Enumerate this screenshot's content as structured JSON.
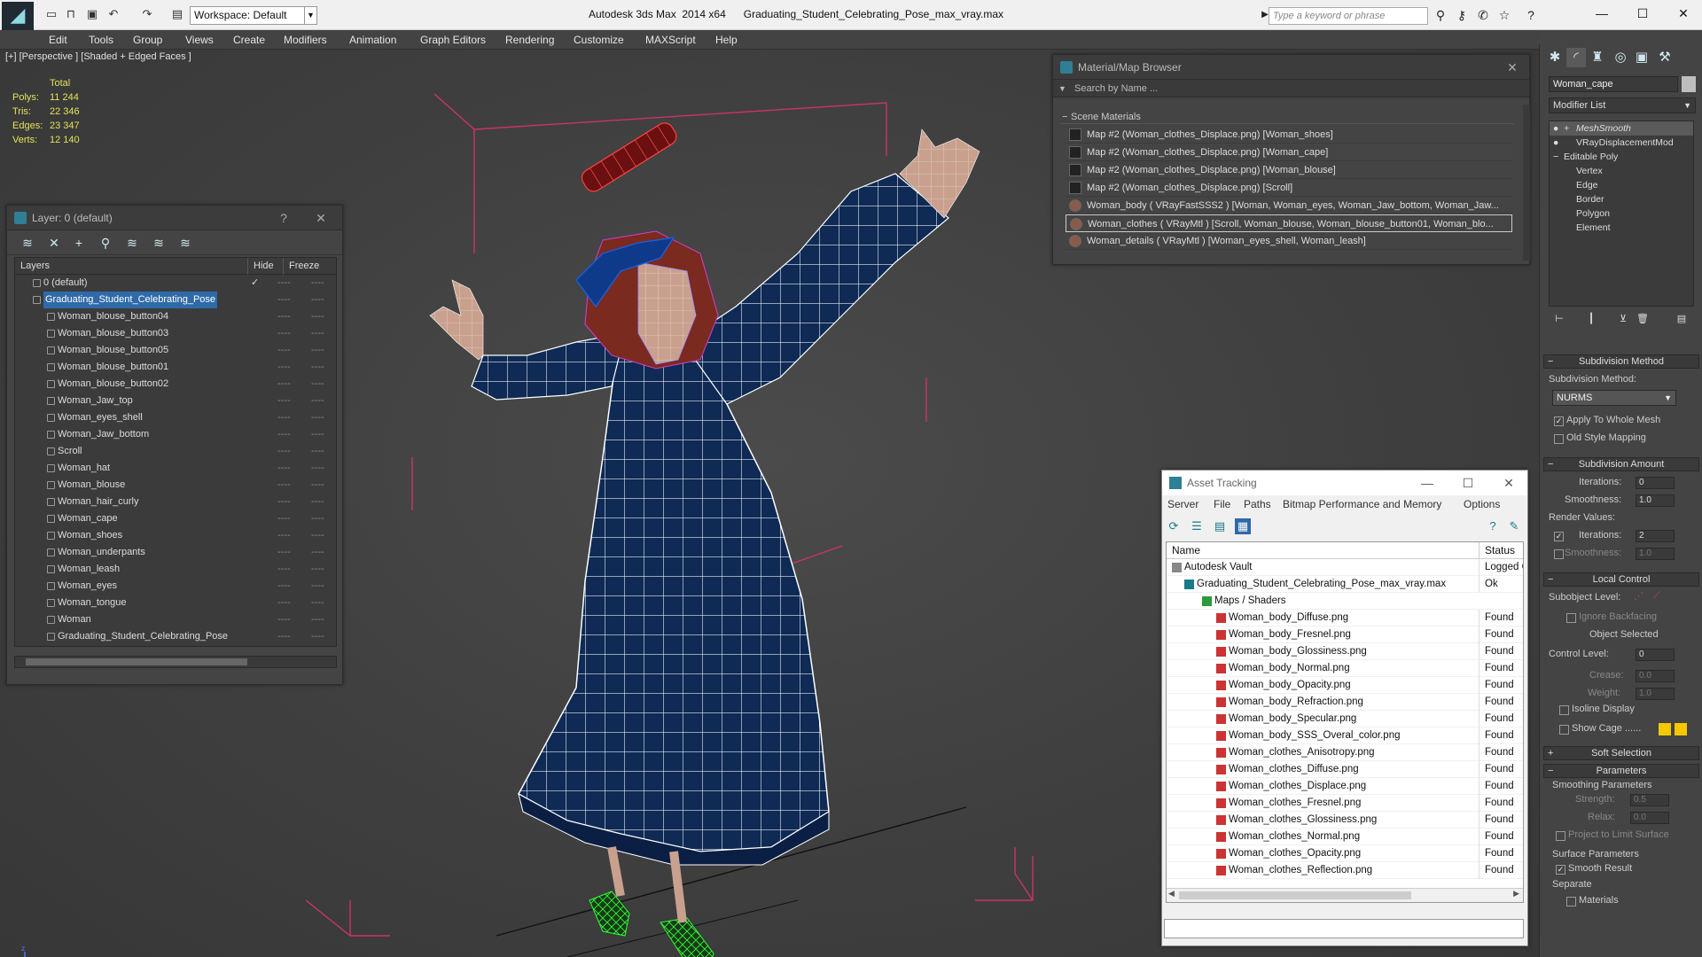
{
  "title_bar": {
    "workspace": "Workspace: Default",
    "window_title": "Autodesk 3ds Max  2014 x64      Graduating_Student_Celebrating_Pose_max_vray.max",
    "search_placeholder": "Type a keyword or phrase",
    "app_icon": "3ds-max-logo-icon",
    "quick_access_icons": [
      "new-file-icon",
      "open-file-icon",
      "save-icon",
      "undo-icon",
      "redo-icon",
      "project-folder-icon"
    ],
    "help_icons": [
      "binoculars-icon",
      "subscription-icon",
      "communication-center-icon",
      "favorites-star-icon",
      "help-icon"
    ],
    "window_controls": [
      "minimize-icon",
      "maximize-icon",
      "close-icon"
    ]
  },
  "menu": [
    "Edit",
    "Tools",
    "Group",
    "Views",
    "Create",
    "Modifiers",
    "Animation",
    "Graph Editors",
    "Rendering",
    "Customize",
    "MAXScript",
    "Help"
  ],
  "viewport": {
    "label": "[+] [Perspective ] [Shaded + Edged Faces ]",
    "stats": {
      "header": "Total",
      "rows": [
        {
          "k": "Polys:",
          "v": "11 244"
        },
        {
          "k": "Tris:",
          "v": "22 346"
        },
        {
          "k": "Edges:",
          "v": "23 347"
        },
        {
          "k": "Verts:",
          "v": "12 140"
        }
      ]
    },
    "axis_labels": {
      "x": "x",
      "y": "y",
      "z": "z"
    },
    "colors": {
      "mesh_fill": "#0e2a55",
      "wire": "#ffffff",
      "cap": "#1b5fd8",
      "skin": "#c9a08e",
      "shoes": "#33ff33",
      "bbox": "#cc3366"
    }
  },
  "layer_panel": {
    "title": "Layer: 0 (default)",
    "title_buttons": [
      "?",
      "✕"
    ],
    "toolbar_icons": [
      "create-layer-icon",
      "delete-layer-icon",
      "add-to-layer-icon",
      "select-in-layer-icon",
      "highlight-layer-icon",
      "hide-all-layers-icon",
      "freeze-all-layers-icon"
    ],
    "columns": {
      "layers": "Layers",
      "hide": "Hide",
      "freeze": "Freeze"
    },
    "rows": [
      {
        "name": "0 (default)",
        "level": 0,
        "checked": true
      },
      {
        "name": "Graduating_Student_Celebrating_Pose",
        "level": 0,
        "selected": true
      },
      {
        "name": "Woman_blouse_button04",
        "level": 1
      },
      {
        "name": "Woman_blouse_button03",
        "level": 1
      },
      {
        "name": "Woman_blouse_button05",
        "level": 1
      },
      {
        "name": "Woman_blouse_button01",
        "level": 1
      },
      {
        "name": "Woman_blouse_button02",
        "level": 1
      },
      {
        "name": "Woman_Jaw_top",
        "level": 1
      },
      {
        "name": "Woman_eyes_shell",
        "level": 1
      },
      {
        "name": "Woman_Jaw_bottom",
        "level": 1
      },
      {
        "name": "Scroll",
        "level": 1
      },
      {
        "name": "Woman_hat",
        "level": 1
      },
      {
        "name": "Woman_blouse",
        "level": 1
      },
      {
        "name": "Woman_hair_curly",
        "level": 1
      },
      {
        "name": "Woman_cape",
        "level": 1
      },
      {
        "name": "Woman_shoes",
        "level": 1
      },
      {
        "name": "Woman_underpants",
        "level": 1
      },
      {
        "name": "Woman_leash",
        "level": 1
      },
      {
        "name": "Woman_eyes",
        "level": 1
      },
      {
        "name": "Woman_tongue",
        "level": 1
      },
      {
        "name": "Woman",
        "level": 1
      },
      {
        "name": "Graduating_Student_Celebrating_Pose",
        "level": 1
      }
    ],
    "dash": "----"
  },
  "material_browser": {
    "title": "Material/Map Browser",
    "search_placeholder": "Search by Name ...",
    "group": "Scene Materials",
    "items": [
      "Map #2 (Woman_clothes_Displace.png) [Woman_shoes]",
      "Map #2 (Woman_clothes_Displace.png) [Woman_cape]",
      "Map #2 (Woman_clothes_Displace.png) [Woman_blouse]",
      "Map #2 (Woman_clothes_Displace.png) [Scroll]",
      "Woman_body  ( VRayFastSSS2 )  [Woman, Woman_eyes, Woman_Jaw_bottom, Woman_Jaw...",
      "Woman_clothes  ( VRayMtl )  [Scroll, Woman_blouse, Woman_blouse_button01, Woman_blo...",
      "Woman_details  ( VRayMtl )  [Woman_eyes_shell, Woman_leash]"
    ]
  },
  "asset_tracking": {
    "title": "Asset Tracking",
    "menu": [
      "Server",
      "File",
      "Paths",
      "Bitmap Performance and Memory",
      "Options"
    ],
    "toolbar_icons": [
      "refresh-icon",
      "list-view-icon",
      "table-view-icon",
      "grid-view-icon",
      "help-icon",
      "vault-icon"
    ],
    "columns": {
      "name": "Name",
      "status": "Status"
    },
    "rows": [
      {
        "name": "Autodesk Vault",
        "status": "Logged O",
        "level": 0,
        "icon": "vault"
      },
      {
        "name": "Graduating_Student_Celebrating_Pose_max_vray.max",
        "status": "Ok",
        "level": 1,
        "icon": "max"
      },
      {
        "name": "Maps / Shaders",
        "status": "",
        "level": 2,
        "icon": "folder"
      },
      {
        "name": "Woman_body_Diffuse.png",
        "status": "Found",
        "level": 3,
        "icon": "png"
      },
      {
        "name": "Woman_body_Fresnel.png",
        "status": "Found",
        "level": 3,
        "icon": "png"
      },
      {
        "name": "Woman_body_Glossiness.png",
        "status": "Found",
        "level": 3,
        "icon": "png"
      },
      {
        "name": "Woman_body_Normal.png",
        "status": "Found",
        "level": 3,
        "icon": "png"
      },
      {
        "name": "Woman_body_Opacity.png",
        "status": "Found",
        "level": 3,
        "icon": "png"
      },
      {
        "name": "Woman_body_Refraction.png",
        "status": "Found",
        "level": 3,
        "icon": "png"
      },
      {
        "name": "Woman_body_Specular.png",
        "status": "Found",
        "level": 3,
        "icon": "png"
      },
      {
        "name": "Woman_body_SSS_Overal_color.png",
        "status": "Found",
        "level": 3,
        "icon": "png"
      },
      {
        "name": "Woman_clothes_Anisotropy.png",
        "status": "Found",
        "level": 3,
        "icon": "png"
      },
      {
        "name": "Woman_clothes_Diffuse.png",
        "status": "Found",
        "level": 3,
        "icon": "png"
      },
      {
        "name": "Woman_clothes_Displace.png",
        "status": "Found",
        "level": 3,
        "icon": "png"
      },
      {
        "name": "Woman_clothes_Fresnel.png",
        "status": "Found",
        "level": 3,
        "icon": "png"
      },
      {
        "name": "Woman_clothes_Glossiness.png",
        "status": "Found",
        "level": 3,
        "icon": "png"
      },
      {
        "name": "Woman_clothes_Normal.png",
        "status": "Found",
        "level": 3,
        "icon": "png"
      },
      {
        "name": "Woman_clothes_Opacity.png",
        "status": "Found",
        "level": 3,
        "icon": "png"
      },
      {
        "name": "Woman_clothes_Reflection.png",
        "status": "Found",
        "level": 3,
        "icon": "png"
      }
    ]
  },
  "command_panel": {
    "tab_icons": [
      "create-tab-icon",
      "modify-tab-icon",
      "hierarchy-tab-icon",
      "motion-tab-icon",
      "display-tab-icon",
      "utilities-tab-icon"
    ],
    "object_name": "Woman_cape",
    "modifier_list": "Modifier List",
    "stack": [
      "MeshSmooth",
      "VRayDisplacementMod",
      "Editable Poly",
      "Vertex",
      "Edge",
      "Border",
      "Polygon",
      "Element"
    ],
    "subdivision_method": {
      "rollout": "Subdivision Method",
      "label": "Subdivision Method:",
      "value": "NURMS",
      "apply_whole_mesh": "Apply To Whole Mesh",
      "old_style_mapping": "Old Style Mapping"
    },
    "subdivision_amount": {
      "rollout": "Subdivision Amount",
      "iterations_label": "Iterations:",
      "iterations": "0",
      "smoothness_label": "Smoothness:",
      "smoothness": "1.0",
      "render_values": "Render Values:",
      "render_iterations": "2",
      "render_smoothness": "1.0"
    },
    "local_control": {
      "rollout": "Local Control",
      "subobject_level": "Subobject Level:",
      "ignore_backfacing": "Ignore Backfacing",
      "object_selected": "Object Selected",
      "control_level_label": "Control Level:",
      "control_level": "0",
      "crease_label": "Crease:",
      "crease": "0.0",
      "weight_label": "Weight:",
      "weight": "1.0",
      "isoline_display": "Isoline Display",
      "show_cage": "Show Cage ......"
    },
    "soft_selection": {
      "rollout": "Soft Selection"
    },
    "parameters": {
      "rollout": "Parameters",
      "smoothing": "Smoothing Parameters",
      "strength_label": "Strength:",
      "strength": "0.5",
      "relax_label": "Relax:",
      "relax": "0.0",
      "project_limit": "Project to Limit Surface",
      "surface": "Surface Parameters",
      "smooth_result": "Smooth Result",
      "separate": "Separate",
      "materials": "Materials"
    }
  }
}
